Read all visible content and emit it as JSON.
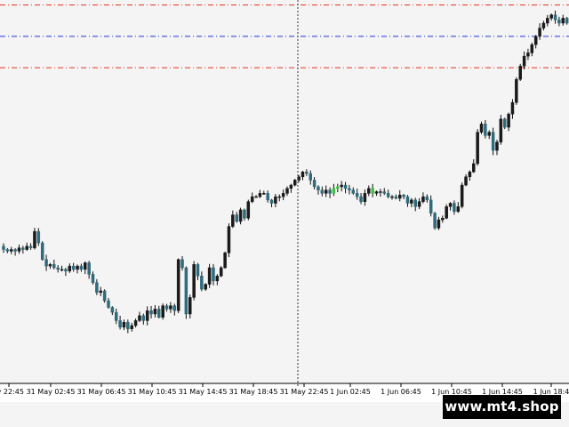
{
  "chart_data": {
    "type": "candlestick",
    "x_tick_labels": [
      "y 22:45",
      "31 May 02:45",
      "31 May 06:45",
      "31 May 10:45",
      "31 May 14:45",
      "31 May 18:45",
      "31 May 22:45",
      "1 Jun 02:45",
      "1 Jun 06:45",
      "1 Jun 10:45",
      "1 Jun 14:45",
      "1 Jun 18:4"
    ],
    "closes": [
      1.1224,
      1.1223,
      1.1224,
      1.1223,
      1.1225,
      1.1224,
      1.1226,
      1.1225,
      1.1235,
      1.1228,
      1.1218,
      1.1214,
      1.1215,
      1.1213,
      1.1212,
      1.1212,
      1.1211,
      1.1214,
      1.1212,
      1.1214,
      1.1212,
      1.1216,
      1.1209,
      1.1204,
      1.1198,
      1.1199,
      1.1193,
      1.1189,
      1.1186,
      1.1181,
      1.1177,
      1.118,
      1.1176,
      1.1178,
      1.1181,
      1.1184,
      1.1181,
      1.1187,
      1.1185,
      1.1188,
      1.1183,
      1.119,
      1.1188,
      1.119,
      1.1187,
      1.1218,
      1.1213,
      1.1185,
      1.1195,
      1.1215,
      1.1208,
      1.12,
      1.1203,
      1.1213,
      1.1205,
      1.1208,
      1.1213,
      1.1222,
      1.1238,
      1.1245,
      1.1241,
      1.1248,
      1.1243,
      1.1253,
      1.1256,
      1.1256,
      1.1258,
      1.1258,
      1.1254,
      1.1252,
      1.1256,
      1.1256,
      1.1258,
      1.1261,
      1.1263,
      1.1266,
      1.1268,
      1.1271,
      1.127,
      1.1266,
      1.1262,
      1.126,
      1.1258,
      1.126,
      1.1258,
      1.1261,
      1.1262,
      1.1263,
      1.1261,
      1.126,
      1.1258,
      1.1256,
      1.1253,
      1.1258,
      1.1261,
      1.1258,
      1.1259,
      1.1259,
      1.1258,
      1.1256,
      1.1256,
      1.1255,
      1.1257,
      1.1256,
      1.1252,
      1.1254,
      1.125,
      1.1253,
      1.1256,
      1.1254,
      1.1246,
      1.1237,
      1.1242,
      1.1243,
      1.125,
      1.1252,
      1.1247,
      1.125,
      1.1263,
      1.1268,
      1.1271,
      1.1276,
      1.1295,
      1.13,
      1.1293,
      1.1295,
      1.1284,
      1.1289,
      1.1303,
      1.1298,
      1.1306,
      1.1313,
      1.1327,
      1.1335,
      1.1341,
      1.1343,
      1.1348,
      1.1353,
      1.1358,
      1.1361,
      1.1364,
      1.1366,
      1.1363,
      1.1361,
      1.1364,
      1.1361,
      1.1363
    ],
    "price_range": [
      1.1143,
      1.1375
    ],
    "levels": [
      {
        "name": "upper",
        "price": 1.1372,
        "color": "#e8301e",
        "style": "dash-dot"
      },
      {
        "name": "middle",
        "price": 1.1353,
        "color": "#1a35d8",
        "style": "dash-dot"
      },
      {
        "name": "lower",
        "price": 1.1334,
        "color": "#e8301e",
        "style": "dash-dot"
      }
    ],
    "vertical_marker": {
      "time_label": "31 May 22:45",
      "color": "#333333",
      "style": "dotted"
    },
    "colors": {
      "bull_body": "#1a1a1a",
      "bear_body": "#2f6b7c",
      "highlight_body": "#3cc43c",
      "wick": "#111111",
      "background": "#f4f4f4",
      "axis": "#000000",
      "tick_label": "#000000"
    },
    "grid": false
  },
  "brand": {
    "badge_text": "www.mt4.shop"
  }
}
